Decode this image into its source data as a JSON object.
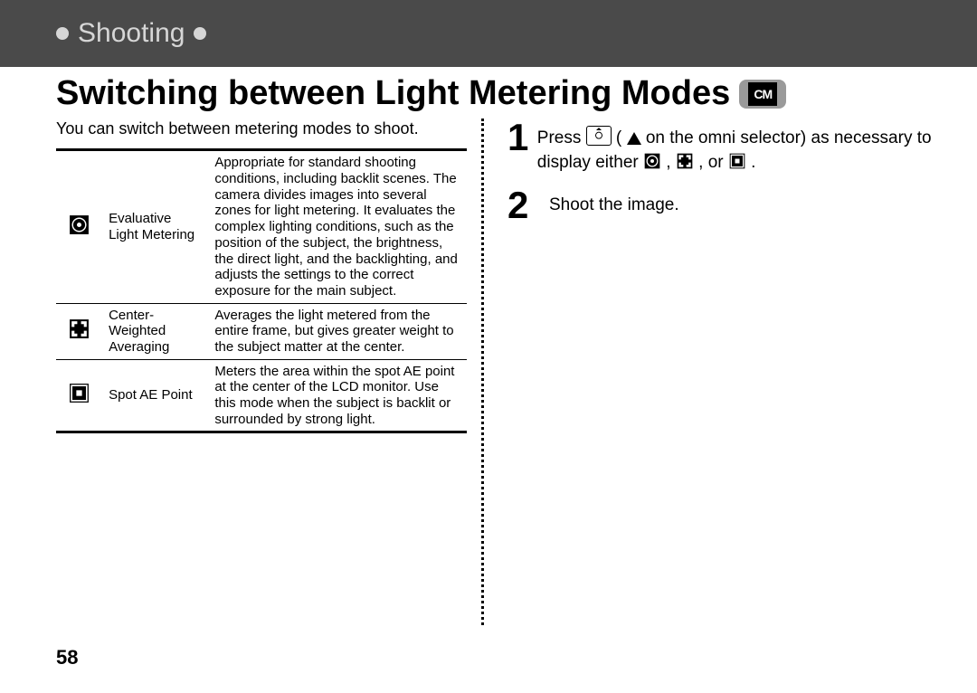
{
  "section_label": "Shooting",
  "title": "Switching between Light Metering Modes",
  "mode_badge": "CM",
  "intro": "You can switch between metering modes to shoot.",
  "table": {
    "rows": [
      {
        "icon": "evaluative-metering-icon",
        "name": "Evaluative Light Metering",
        "desc": "Appropriate for standard shooting conditions, including backlit scenes. The camera divides images into several zones for light metering. It evaluates the complex lighting conditions, such as the position of the subject, the brightness, the direct light, and the backlighting, and adjusts the settings to the correct exposure for the main subject."
      },
      {
        "icon": "center-weighted-metering-icon",
        "name": "Center-Weighted Averaging",
        "desc": "Averages the light metered from the entire frame, but gives greater weight to the subject matter at the center."
      },
      {
        "icon": "spot-ae-metering-icon",
        "name": "Spot AE Point",
        "desc": "Meters the area within the spot AE point at the center of the LCD monitor.  Use this mode when the subject is backlit or surrounded by strong light."
      }
    ]
  },
  "steps": [
    {
      "num": "1",
      "pre": "Press ",
      "mid1": " (",
      "mid2": " on the omni selector) as necessary to display either ",
      "sep": ", ",
      "or": ", or ",
      "end": "."
    },
    {
      "num": "2",
      "text": "Shoot the image."
    }
  ],
  "page_number": "58"
}
